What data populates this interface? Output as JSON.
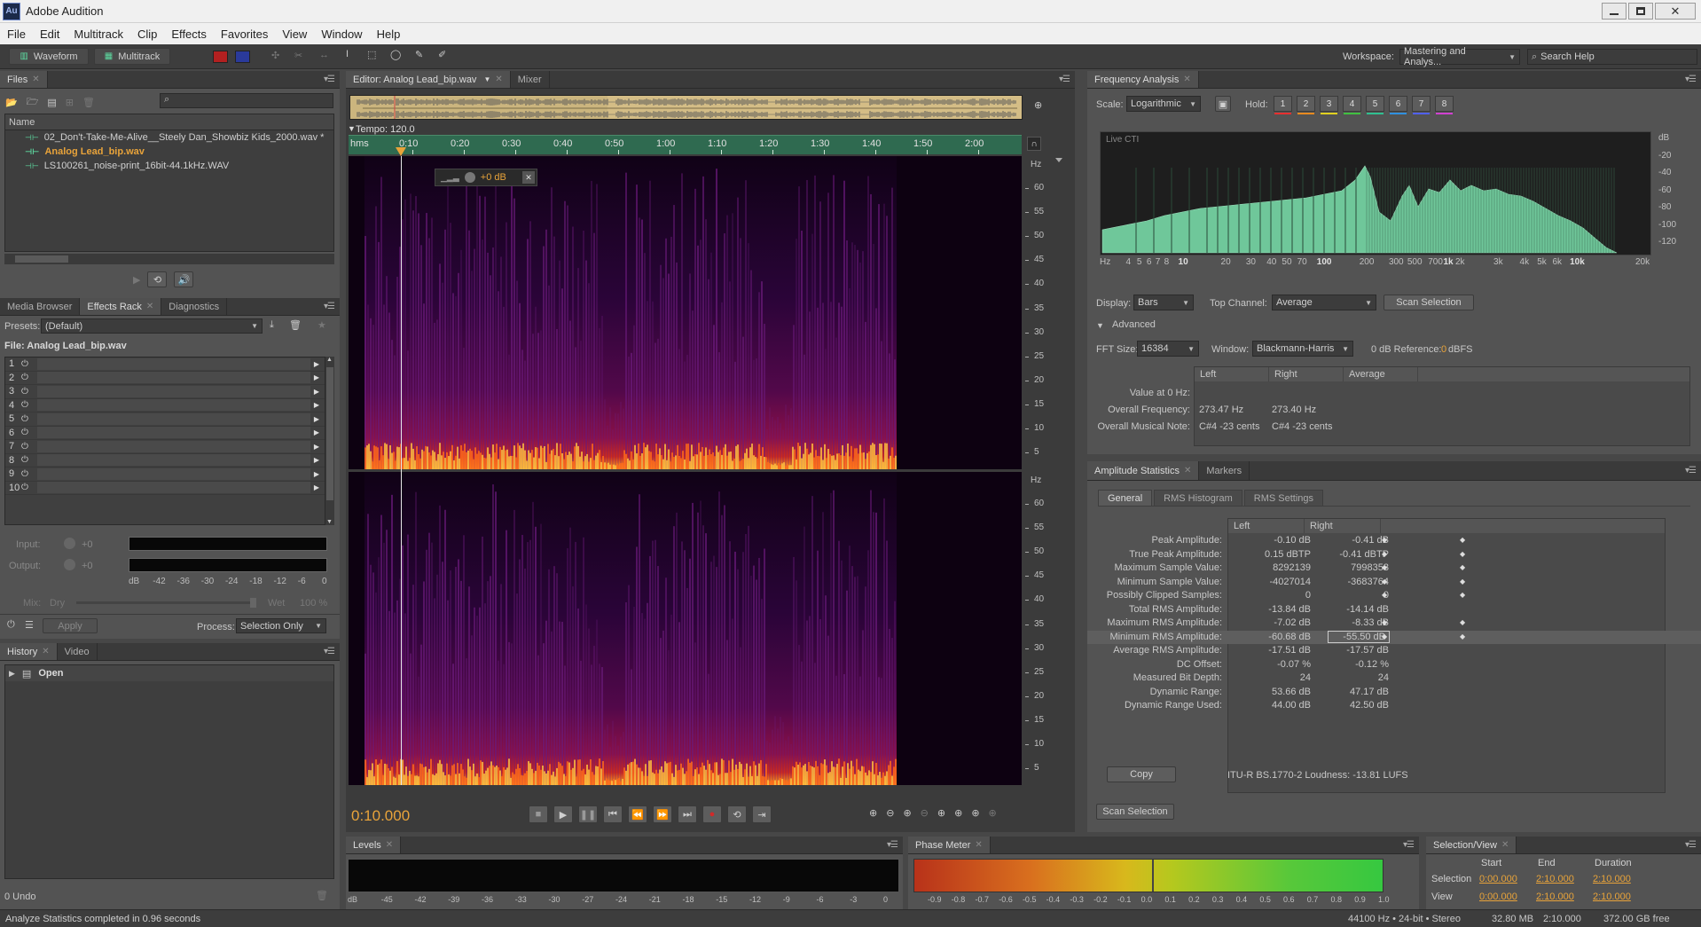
{
  "app": {
    "title": "Adobe Audition",
    "logo_text": "Au"
  },
  "menu": [
    "File",
    "Edit",
    "Multitrack",
    "Clip",
    "Effects",
    "Favorites",
    "View",
    "Window",
    "Help"
  ],
  "toolbar": {
    "waveform_label": "Waveform",
    "multitrack_label": "Multitrack",
    "workspace_label": "Workspace:",
    "workspace_value": "Mastering and Analys...",
    "search_placeholder": "Search Help"
  },
  "files_panel": {
    "tab": "Files",
    "column_name": "Name",
    "files": [
      "02_Don't-Take-Me-Alive__Steely Dan_Showbiz Kids_2000.wav *",
      "Analog Lead_bip.wav",
      "LS100261_noise-print_16bit-44.1kHz.WAV"
    ]
  },
  "effects_panel": {
    "tabs": [
      "Media Browser",
      "Effects Rack",
      "Diagnostics"
    ],
    "presets_label": "Presets:",
    "presets_value": "(Default)",
    "file_label": "File: Analog Lead_bip.wav",
    "slots": [
      "1",
      "2",
      "3",
      "4",
      "5",
      "6",
      "7",
      "8",
      "9",
      "10"
    ],
    "input_label": "Input:",
    "output_label": "Output:",
    "input_db": "+0",
    "output_db": "+0",
    "meter_scale": [
      "dB",
      "-42",
      "-36",
      "-30",
      "-24",
      "-18",
      "-12",
      "-6",
      "0"
    ],
    "mix_label": "Mix:",
    "mix_dry": "Dry",
    "mix_wet": "Wet",
    "mix_value": "100 %",
    "apply_label": "Apply",
    "process_label": "Process:",
    "process_value": "Selection Only"
  },
  "history_panel": {
    "tabs": [
      "History",
      "Video"
    ],
    "items": [
      "Open"
    ],
    "undo_count": "0 Undo"
  },
  "editor": {
    "tab": "Editor: Analog Lead_bip.wav",
    "mixer_tab": "Mixer",
    "tempo": "Tempo: 120.0",
    "ruler": [
      "hms",
      "0:10",
      "0:20",
      "0:30",
      "0:40",
      "0:50",
      "1:00",
      "1:10",
      "1:20",
      "1:30",
      "1:40",
      "1:50",
      "2:00"
    ],
    "hud_gain": "+0 dB",
    "hz_label": "Hz",
    "hz_ticks": [
      "60",
      "55",
      "50",
      "45",
      "40",
      "35",
      "30",
      "25",
      "20",
      "15",
      "10",
      "5"
    ],
    "time_display": "0:10.000"
  },
  "levels_panel": {
    "tab": "Levels",
    "scale": [
      "dB",
      "-45",
      "-42",
      "-39",
      "-36",
      "-33",
      "-30",
      "-27",
      "-24",
      "-21",
      "-18",
      "-15",
      "-12",
      "-9",
      "-6",
      "-3",
      "0"
    ]
  },
  "phase_panel": {
    "tab": "Phase Meter",
    "scale": [
      "-0.9",
      "-0.8",
      "-0.7",
      "-0.6",
      "-0.5",
      "-0.4",
      "-0.3",
      "-0.2",
      "-0.1",
      "0.0",
      "0.1",
      "0.2",
      "0.3",
      "0.4",
      "0.5",
      "0.6",
      "0.7",
      "0.8",
      "0.9",
      "1.0"
    ]
  },
  "selection_view": {
    "tab": "Selection/View",
    "headers": [
      "Start",
      "End",
      "Duration"
    ],
    "rows": [
      {
        "label": "Selection",
        "start": "0:00.000",
        "end": "2:10.000",
        "duration": "2:10.000"
      },
      {
        "label": "View",
        "start": "0:00.000",
        "end": "2:10.000",
        "duration": "2:10.000"
      }
    ]
  },
  "freq_analysis": {
    "tab": "Frequency Analysis",
    "scale_label": "Scale:",
    "scale_value": "Logarithmic",
    "hold_label": "Hold:",
    "hold_buttons": [
      "1",
      "2",
      "3",
      "4",
      "5",
      "6",
      "7",
      "8"
    ],
    "hold_colors": [
      "#e83030",
      "#e88a20",
      "#e0d020",
      "#40c040",
      "#30c090",
      "#3090e0",
      "#5060f0",
      "#d040d0"
    ],
    "live_label": "Live CTI",
    "db_ticks": [
      "dB",
      "-20",
      "-40",
      "-60",
      "-80",
      "-100",
      "-120"
    ],
    "hz_ticks": [
      "Hz",
      "4",
      "5",
      "6",
      "7",
      "8",
      "10",
      "20",
      "30",
      "40",
      "50",
      "70",
      "100",
      "200",
      "300",
      "500",
      "700",
      "1k",
      "2k",
      "3k",
      "4k",
      "5k",
      "6k",
      "10k",
      "20k"
    ],
    "display_label": "Display:",
    "display_value": "Bars",
    "top_channel_label": "Top Channel:",
    "top_channel_value": "Average",
    "scan_label": "Scan Selection",
    "advanced_label": "Advanced",
    "fft_label": "FFT Size:",
    "fft_value": "16384",
    "window_label": "Window:",
    "window_value": "Blackmann-Harris",
    "ref_label": "0 dB Reference:",
    "ref_value": "0",
    "ref_unit": "dBFS",
    "table_headers": [
      "Left",
      "Right",
      "Average"
    ],
    "value_at_label": "Value at 0 Hz:",
    "overall_freq_label": "Overall Frequency:",
    "overall_freq_left": "273.47 Hz",
    "overall_freq_right": "273.40 Hz",
    "musical_note_label": "Overall Musical Note:",
    "musical_note_left": "C#4 -23 cents",
    "musical_note_right": "C#4 -23 cents"
  },
  "amp_stats": {
    "tabs": [
      "Amplitude Statistics",
      "Markers"
    ],
    "subtabs": [
      "General",
      "RMS Histogram",
      "RMS Settings"
    ],
    "headers": [
      "Left",
      "Right"
    ],
    "rows": [
      {
        "label": "Peak Amplitude:",
        "left": "-0.10 dB",
        "right": "-0.41 dB"
      },
      {
        "label": "True Peak Amplitude:",
        "left": "0.15 dBTP",
        "right": "-0.41 dBTP"
      },
      {
        "label": "Maximum Sample Value:",
        "left": "8292139",
        "right": "7998353"
      },
      {
        "label": "Minimum Sample Value:",
        "left": "-4027014",
        "right": "-3683764"
      },
      {
        "label": "Possibly Clipped Samples:",
        "left": "0",
        "right": "0"
      },
      {
        "label": "Total RMS Amplitude:",
        "left": "-13.84 dB",
        "right": "-14.14 dB"
      },
      {
        "label": "Maximum RMS Amplitude:",
        "left": "-7.02 dB",
        "right": "-8.33 dB"
      },
      {
        "label": "Minimum RMS Amplitude:",
        "left": "-60.68 dB",
        "right": "-55.50 dB"
      },
      {
        "label": "Average RMS Amplitude:",
        "left": "-17.51 dB",
        "right": "-17.57 dB"
      },
      {
        "label": "DC Offset:",
        "left": "-0.07 %",
        "right": "-0.12 %"
      },
      {
        "label": "Measured Bit Depth:",
        "left": "24",
        "right": "24"
      },
      {
        "label": "Dynamic Range:",
        "left": "53.66 dB",
        "right": "47.17 dB"
      },
      {
        "label": "Dynamic Range Used:",
        "left": "44.00 dB",
        "right": "42.50 dB"
      }
    ],
    "copy_label": "Copy",
    "loudness": "ITU-R BS.1770-2 Loudness: -13.81 LUFS",
    "scan_label": "Scan Selection"
  },
  "status": {
    "message": "Analyze Statistics completed in 0.96 seconds",
    "format": "44100 Hz • 24-bit • Stereo",
    "size": "32.80 MB",
    "duration": "2:10.000",
    "free": "372.00 GB free"
  }
}
